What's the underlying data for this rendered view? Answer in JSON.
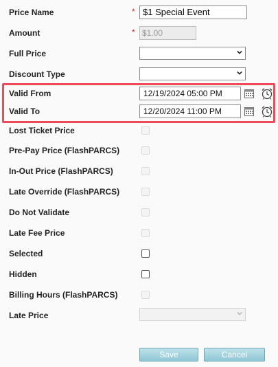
{
  "price_name": {
    "label": "Price Name",
    "required_mark": "*",
    "value": "$1 Special Event"
  },
  "amount": {
    "label": "Amount",
    "required_mark": "*",
    "value": "$1.00"
  },
  "full_price": {
    "label": "Full Price",
    "value": ""
  },
  "discount_type": {
    "label": "Discount Type",
    "value": ""
  },
  "valid_from": {
    "label": "Valid From",
    "value": "12/19/2024 05:00 PM"
  },
  "valid_to": {
    "label": "Valid To",
    "value": "12/20/2024 11:00 PM"
  },
  "checkboxes": [
    {
      "label": "Lost Ticket Price",
      "checked": false,
      "enabled": false
    },
    {
      "label": "Pre-Pay Price (FlashPARCS)",
      "checked": false,
      "enabled": false
    },
    {
      "label": "In-Out Price (FlashPARCS)",
      "checked": false,
      "enabled": false
    },
    {
      "label": "Late Override (FlashPARCS)",
      "checked": false,
      "enabled": false
    },
    {
      "label": "Do Not Validate",
      "checked": false,
      "enabled": false
    },
    {
      "label": "Late Fee Price",
      "checked": false,
      "enabled": false
    },
    {
      "label": "Selected",
      "checked": false,
      "enabled": true
    },
    {
      "label": "Hidden",
      "checked": false,
      "enabled": true
    },
    {
      "label": "Billing Hours (FlashPARCS)",
      "checked": false,
      "enabled": false
    }
  ],
  "late_price": {
    "label": "Late Price",
    "value": ""
  },
  "buttons": {
    "save": "Save",
    "cancel": "Cancel"
  },
  "colors": {
    "required": "#d9251c",
    "highlight": "#ef4a59",
    "button": "#8ec6d4"
  },
  "icons": {
    "calendar": "calendar-icon",
    "clock": "alarm-clock-icon",
    "dropdown": "chevron-down-icon"
  }
}
